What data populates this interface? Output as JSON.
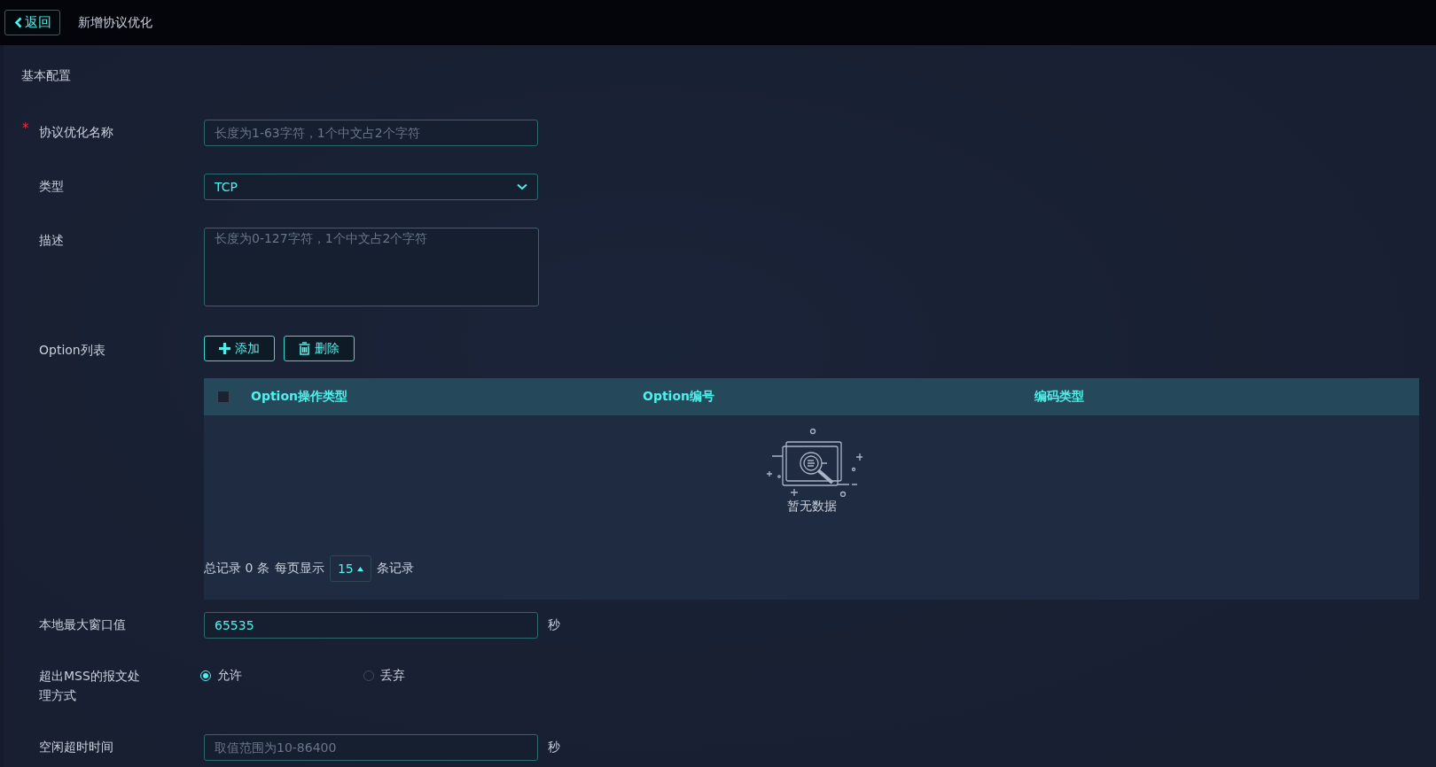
{
  "header": {
    "back_label": "返回",
    "title": "新增协议优化"
  },
  "section_title": "基本配置",
  "required_symbol": "*",
  "fields": [
    {
      "kind": "input",
      "label": "协议优化名称",
      "required": true,
      "placeholder": "长度为1-63字符，1个中文占2个字符"
    },
    {
      "kind": "select",
      "label": "类型",
      "required": false,
      "value": "TCP"
    },
    {
      "kind": "textarea",
      "label": "描述",
      "required": false,
      "placeholder": "长度为0-127字符，1个中文占2个字符"
    },
    {
      "kind": "table",
      "label": "Option列表",
      "required": false,
      "buttons": [
        {
          "kind": "add",
          "label": "添加"
        },
        {
          "kind": "delete",
          "label": "删除"
        }
      ],
      "select_all_checked": false,
      "columns": [
        "Option操作类型",
        "Option编号",
        "编码类型"
      ],
      "empty_text": "暂无数据",
      "pager": {
        "total": "总记录 0 条",
        "per_page_label": "每页显示",
        "per_page": "15",
        "suffix": "条记录"
      }
    },
    {
      "kind": "input",
      "label": "本地最大窗口值",
      "required": false,
      "value": "65535",
      "unit": "秒"
    },
    {
      "kind": "radio",
      "label": "超出MSS的报文处理方式",
      "required": false,
      "options": [
        {
          "label": "允许",
          "selected": true
        },
        {
          "label": "丢弃",
          "selected": false
        }
      ]
    },
    {
      "kind": "input",
      "label": "空闲超时时间",
      "required": false,
      "placeholder": "取值范围为10-86400",
      "unit": "秒"
    }
  ]
}
